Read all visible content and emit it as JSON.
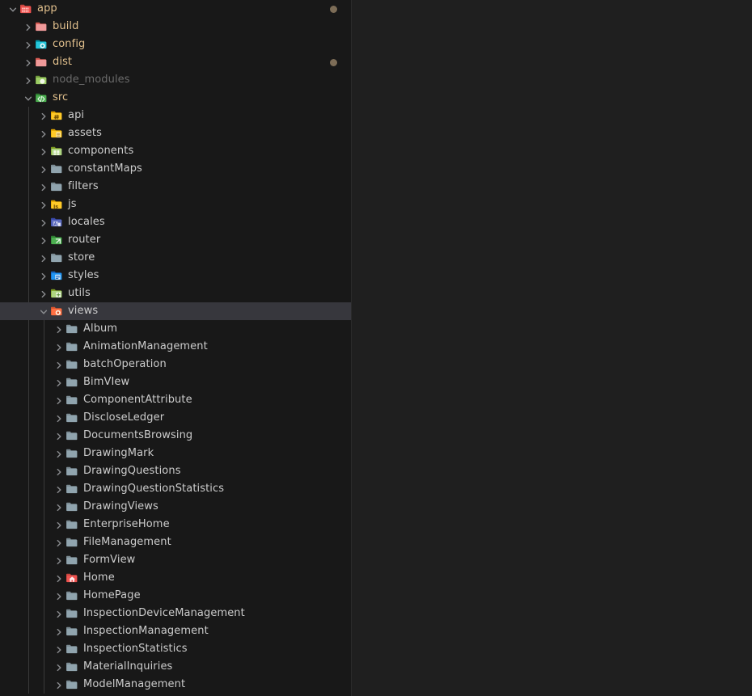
{
  "window": {
    "panel_background": "#181818",
    "editor_background": "#1f1f1f",
    "selection_background": "#37373d",
    "text_color": "#cccccc",
    "modified_color": "#e2c08d",
    "ignored_color": "#6a6a6a",
    "decoration_dot_color": "#7d6d57"
  },
  "explorer": {
    "rows": [
      {
        "label": "app",
        "depth": 0,
        "expanded": true,
        "icon": "folder-app-icon",
        "state": "modified",
        "dot": true,
        "selected": false
      },
      {
        "label": "build",
        "depth": 1,
        "expanded": false,
        "icon": "folder-dist-icon",
        "state": "modified",
        "dot": false,
        "selected": false
      },
      {
        "label": "config",
        "depth": 1,
        "expanded": false,
        "icon": "folder-config-icon",
        "state": "modified",
        "dot": false,
        "selected": false
      },
      {
        "label": "dist",
        "depth": 1,
        "expanded": false,
        "icon": "folder-dist-icon",
        "state": "modified",
        "dot": true,
        "selected": false
      },
      {
        "label": "node_modules",
        "depth": 1,
        "expanded": false,
        "icon": "folder-node-icon",
        "state": "ignored",
        "dot": false,
        "selected": false
      },
      {
        "label": "src",
        "depth": 1,
        "expanded": true,
        "icon": "folder-src-icon",
        "state": "modified",
        "dot": false,
        "selected": false
      },
      {
        "label": "api",
        "depth": 2,
        "expanded": false,
        "icon": "folder-api-icon",
        "state": "normal",
        "dot": false,
        "selected": false
      },
      {
        "label": "assets",
        "depth": 2,
        "expanded": false,
        "icon": "folder-assets-icon",
        "state": "normal",
        "dot": false,
        "selected": false
      },
      {
        "label": "components",
        "depth": 2,
        "expanded": false,
        "icon": "folder-components-icon",
        "state": "normal",
        "dot": false,
        "selected": false
      },
      {
        "label": "constantMaps",
        "depth": 2,
        "expanded": false,
        "icon": "folder-icon",
        "state": "normal",
        "dot": false,
        "selected": false
      },
      {
        "label": "filters",
        "depth": 2,
        "expanded": false,
        "icon": "folder-icon",
        "state": "normal",
        "dot": false,
        "selected": false
      },
      {
        "label": "js",
        "depth": 2,
        "expanded": false,
        "icon": "folder-js-icon",
        "state": "normal",
        "dot": false,
        "selected": false
      },
      {
        "label": "locales",
        "depth": 2,
        "expanded": false,
        "icon": "folder-locales-icon",
        "state": "normal",
        "dot": false,
        "selected": false
      },
      {
        "label": "router",
        "depth": 2,
        "expanded": false,
        "icon": "folder-router-icon",
        "state": "normal",
        "dot": false,
        "selected": false
      },
      {
        "label": "store",
        "depth": 2,
        "expanded": false,
        "icon": "folder-icon",
        "state": "normal",
        "dot": false,
        "selected": false
      },
      {
        "label": "styles",
        "depth": 2,
        "expanded": false,
        "icon": "folder-styles-icon",
        "state": "normal",
        "dot": false,
        "selected": false
      },
      {
        "label": "utils",
        "depth": 2,
        "expanded": false,
        "icon": "folder-utils-icon",
        "state": "normal",
        "dot": false,
        "selected": false
      },
      {
        "label": "views",
        "depth": 2,
        "expanded": true,
        "icon": "folder-views-icon",
        "state": "normal",
        "dot": false,
        "selected": true
      },
      {
        "label": "Album",
        "depth": 3,
        "expanded": false,
        "icon": "folder-icon",
        "state": "normal",
        "dot": false,
        "selected": false
      },
      {
        "label": "AnimationManagement",
        "depth": 3,
        "expanded": false,
        "icon": "folder-icon",
        "state": "normal",
        "dot": false,
        "selected": false
      },
      {
        "label": "batchOperation",
        "depth": 3,
        "expanded": false,
        "icon": "folder-icon",
        "state": "normal",
        "dot": false,
        "selected": false
      },
      {
        "label": "BimVIew",
        "depth": 3,
        "expanded": false,
        "icon": "folder-icon",
        "state": "normal",
        "dot": false,
        "selected": false
      },
      {
        "label": "ComponentAttribute",
        "depth": 3,
        "expanded": false,
        "icon": "folder-icon",
        "state": "normal",
        "dot": false,
        "selected": false
      },
      {
        "label": "DiscloseLedger",
        "depth": 3,
        "expanded": false,
        "icon": "folder-icon",
        "state": "normal",
        "dot": false,
        "selected": false
      },
      {
        "label": "DocumentsBrowsing",
        "depth": 3,
        "expanded": false,
        "icon": "folder-icon",
        "state": "normal",
        "dot": false,
        "selected": false
      },
      {
        "label": "DrawingMark",
        "depth": 3,
        "expanded": false,
        "icon": "folder-icon",
        "state": "normal",
        "dot": false,
        "selected": false
      },
      {
        "label": "DrawingQuestions",
        "depth": 3,
        "expanded": false,
        "icon": "folder-icon",
        "state": "normal",
        "dot": false,
        "selected": false
      },
      {
        "label": "DrawingQuestionStatistics",
        "depth": 3,
        "expanded": false,
        "icon": "folder-icon",
        "state": "normal",
        "dot": false,
        "selected": false
      },
      {
        "label": "DrawingViews",
        "depth": 3,
        "expanded": false,
        "icon": "folder-icon",
        "state": "normal",
        "dot": false,
        "selected": false
      },
      {
        "label": "EnterpriseHome",
        "depth": 3,
        "expanded": false,
        "icon": "folder-icon",
        "state": "normal",
        "dot": false,
        "selected": false
      },
      {
        "label": "FileManagement",
        "depth": 3,
        "expanded": false,
        "icon": "folder-icon",
        "state": "normal",
        "dot": false,
        "selected": false
      },
      {
        "label": "FormView",
        "depth": 3,
        "expanded": false,
        "icon": "folder-icon",
        "state": "normal",
        "dot": false,
        "selected": false
      },
      {
        "label": "Home",
        "depth": 3,
        "expanded": false,
        "icon": "folder-home-icon",
        "state": "normal",
        "dot": false,
        "selected": false
      },
      {
        "label": "HomePage",
        "depth": 3,
        "expanded": false,
        "icon": "folder-icon",
        "state": "normal",
        "dot": false,
        "selected": false
      },
      {
        "label": "InspectionDeviceManagement",
        "depth": 3,
        "expanded": false,
        "icon": "folder-icon",
        "state": "normal",
        "dot": false,
        "selected": false
      },
      {
        "label": "InspectionManagement",
        "depth": 3,
        "expanded": false,
        "icon": "folder-icon",
        "state": "normal",
        "dot": false,
        "selected": false
      },
      {
        "label": "InspectionStatistics",
        "depth": 3,
        "expanded": false,
        "icon": "folder-icon",
        "state": "normal",
        "dot": false,
        "selected": false
      },
      {
        "label": "MaterialInquiries",
        "depth": 3,
        "expanded": false,
        "icon": "folder-icon",
        "state": "normal",
        "dot": false,
        "selected": false
      },
      {
        "label": "ModelManagement",
        "depth": 3,
        "expanded": false,
        "icon": "folder-icon",
        "state": "normal",
        "dot": false,
        "selected": false
      }
    ]
  }
}
